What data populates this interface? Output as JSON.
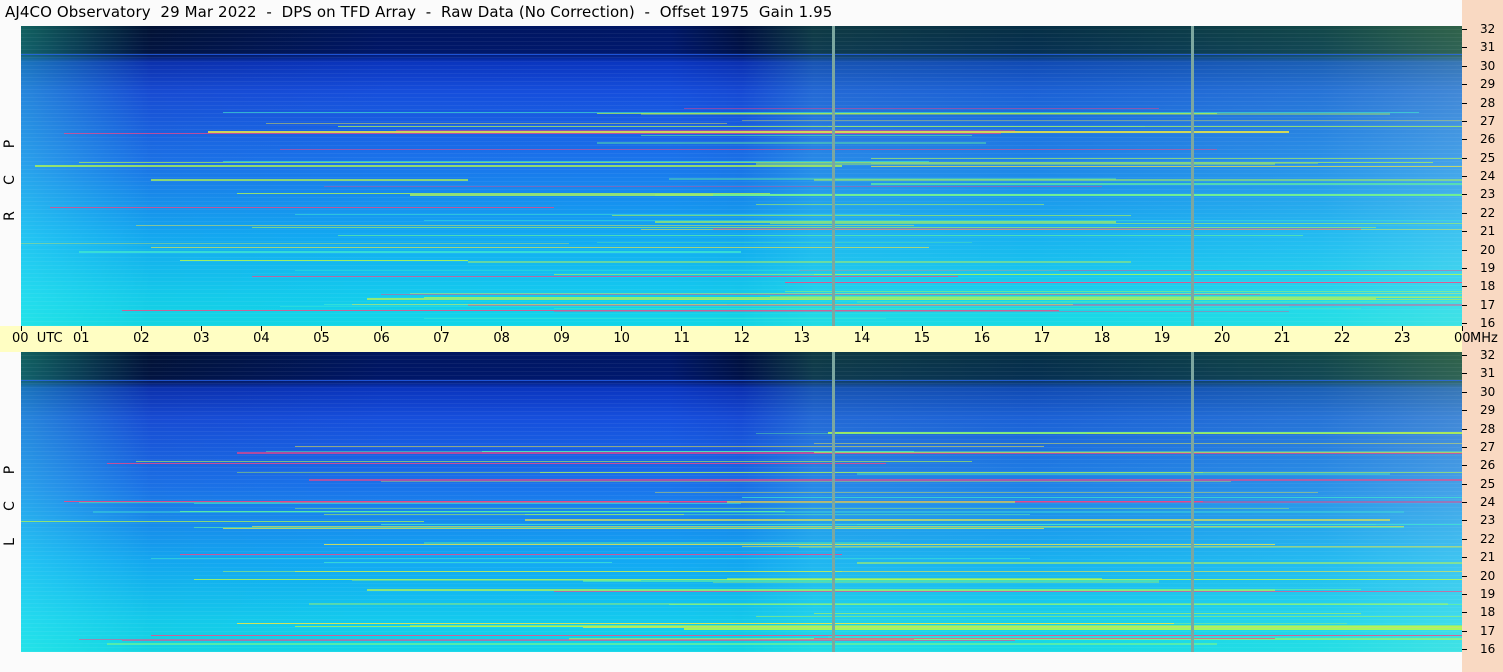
{
  "header": {
    "title": "AJ4CO Observatory  29 Mar 2022  -  DPS on TFD Array  -  Raw Data (No Correction)  -  Offset 1975  Gain 1.95"
  },
  "panels": [
    {
      "id": "top",
      "letters": [
        "R",
        "C",
        "P"
      ]
    },
    {
      "id": "bot",
      "letters": [
        "L",
        "C",
        "P"
      ]
    }
  ],
  "time_axis": {
    "labels": [
      "00  UTC",
      "01",
      "02",
      "03",
      "04",
      "05",
      "06",
      "07",
      "08",
      "09",
      "10",
      "11",
      "12",
      "13",
      "14",
      "15",
      "16",
      "17",
      "18",
      "19",
      "20",
      "21",
      "22",
      "23",
      "00"
    ]
  },
  "freq_axis": {
    "unit": "MHz",
    "labels": [
      "32",
      "31",
      "30",
      "29",
      "28",
      "27",
      "26",
      "25",
      "24",
      "23",
      "22",
      "21",
      "20",
      "19",
      "18",
      "17",
      "16"
    ]
  },
  "colors": {
    "axis_bar": "#fffec3",
    "right_strip": "#f9d9c2",
    "divider": "#7ca7a0"
  }
}
